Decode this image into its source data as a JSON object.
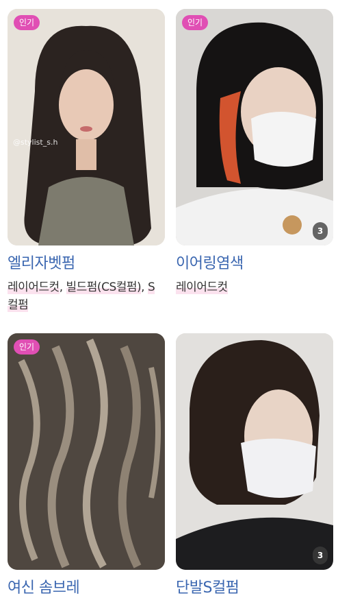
{
  "cards": [
    {
      "badge": "인기",
      "title": "엘리자벳펌",
      "tags": [
        "레이어드컷",
        "빌드펌(CS컬펌)",
        "S컬펌"
      ],
      "watermark": "@stylist_s.h",
      "photo_count": ""
    },
    {
      "badge": "인기",
      "title": "이어링염색",
      "tags": [
        "레이어드컷"
      ],
      "watermark": "",
      "photo_count": "3"
    },
    {
      "badge": "인기",
      "title": "여신 솜브레",
      "tags": [],
      "watermark": "",
      "photo_count": ""
    },
    {
      "badge": "",
      "title": "단발S컬펌",
      "tags": [],
      "watermark": "",
      "photo_count": "3"
    }
  ],
  "colors": {
    "badge_bg": "#e04fb4",
    "title_text": "#3a66b0",
    "tag_highlight": "#fbe2ee"
  },
  "icons": {
    "photo_count": "photo-count-badge"
  }
}
